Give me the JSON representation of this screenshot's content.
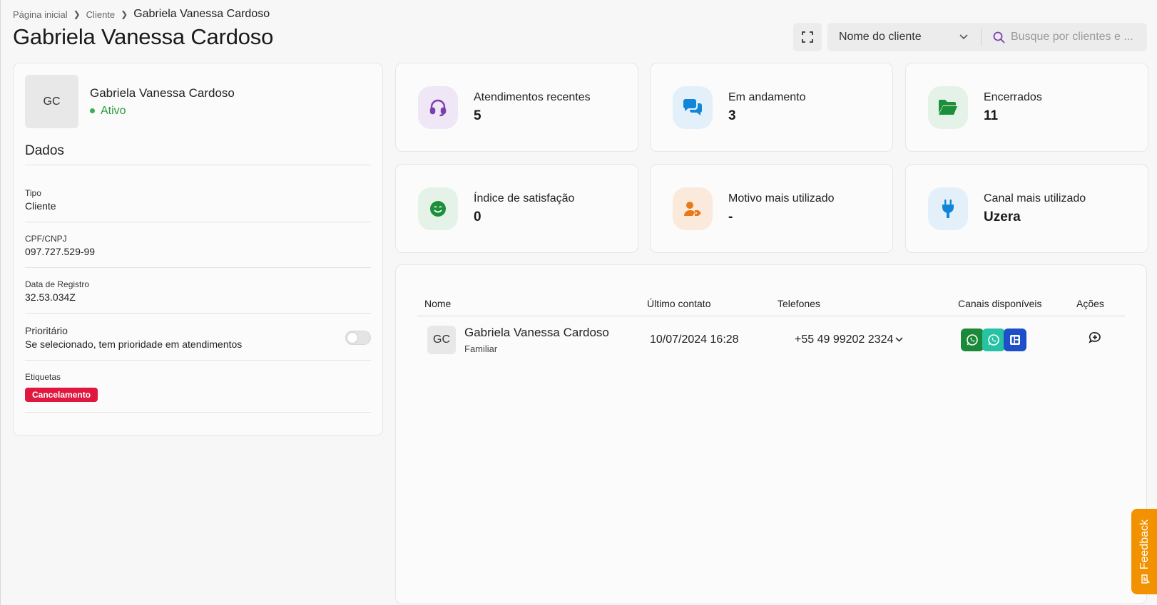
{
  "breadcrumb": {
    "home": "Página inicial",
    "section": "Cliente",
    "current": "Gabriela Vanessa Cardoso"
  },
  "page": {
    "title": "Gabriela Vanessa Cardoso"
  },
  "toolbar": {
    "filter_value": "Nome do cliente",
    "search_placeholder": "Busque por clientes e ..."
  },
  "profile": {
    "initials": "GC",
    "name": "Gabriela Vanessa Cardoso",
    "status": "Ativo",
    "section_title": "Dados",
    "fields": [
      {
        "label": "Tipo",
        "value": "Cliente"
      },
      {
        "label": "CPF/CNPJ",
        "value": "097.727.529-99"
      },
      {
        "label": "Data de Registro",
        "value": "32.53.034Z"
      }
    ],
    "priority": {
      "label": "Prioritário",
      "description": "Se selecionado, tem prioridade em atendimentos",
      "enabled": false
    },
    "tags_label": "Etiquetas",
    "tags": [
      "Cancelamento"
    ]
  },
  "stats": [
    {
      "label": "Atendimentos recentes",
      "value": "5",
      "icon": "headset-icon",
      "icon_color": "#7a3fb0",
      "bg": "#efe6f6"
    },
    {
      "label": "Em andamento",
      "value": "3",
      "icon": "chat-bubbles-icon",
      "icon_color": "#1186d8",
      "bg": "#e3f0f9"
    },
    {
      "label": "Encerrados",
      "value": "11",
      "icon": "folder-open-icon",
      "icon_color": "#1c8f3a",
      "bg": "#e4f2e7"
    },
    {
      "label": "Índice de satisfação",
      "value": "0",
      "icon": "smile-icon",
      "icon_color": "#1c8f3a",
      "bg": "#e4f2e7"
    },
    {
      "label": "Motivo mais utilizado",
      "value": "-",
      "icon": "user-tag-icon",
      "icon_color": "#e8791a",
      "bg": "#fbe9dc"
    },
    {
      "label": "Canal mais utilizado",
      "value": "Uzera",
      "icon": "plug-icon",
      "icon_color": "#1186d8",
      "bg": "#e3f0f9"
    }
  ],
  "table": {
    "headers": {
      "nome": "Nome",
      "ultimo": "Último contato",
      "telefones": "Telefones",
      "canais": "Canais disponíveis",
      "acoes": "Ações"
    },
    "rows": [
      {
        "initials": "GC",
        "name": "Gabriela Vanessa Cardoso",
        "relation": "Familiar",
        "last_contact": "10/07/2024 16:28",
        "phone": "+55 49 99202 2324",
        "channels": [
          {
            "icon": "whatsapp-icon",
            "color": "#1a8a3a"
          },
          {
            "icon": "whatsapp-business-icon",
            "color": "#27c2a4"
          },
          {
            "icon": "webchat-icon",
            "color": "#1d4fc9"
          }
        ]
      }
    ]
  },
  "feedback": {
    "label": "Feedback"
  }
}
